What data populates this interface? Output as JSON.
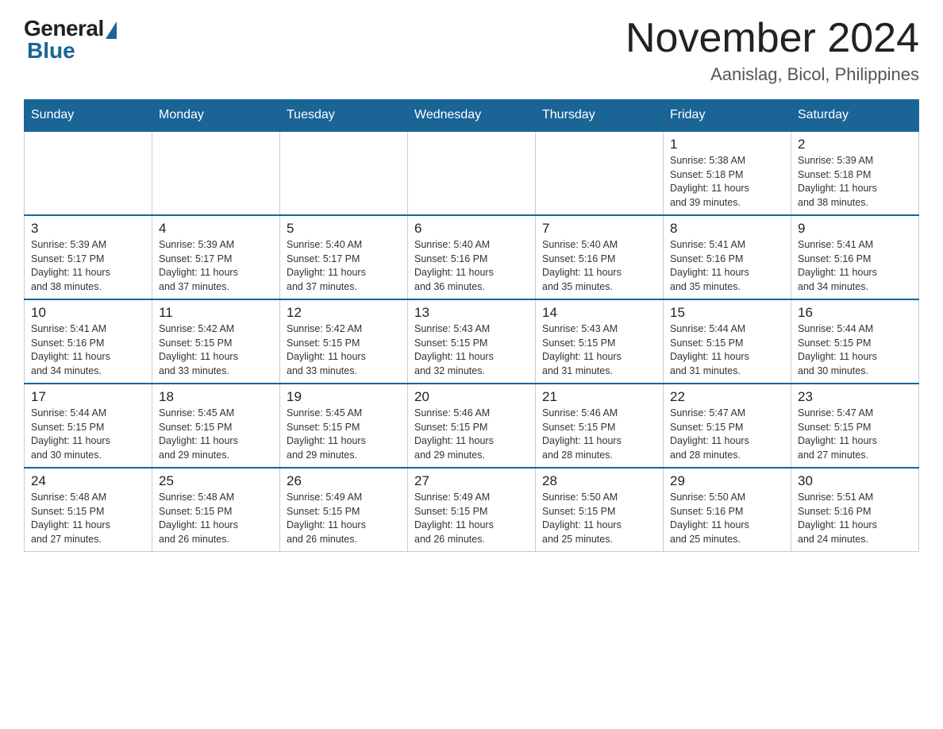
{
  "header": {
    "logo_general": "General",
    "logo_blue": "Blue",
    "month_title": "November 2024",
    "location": "Aanislag, Bicol, Philippines"
  },
  "days_of_week": [
    "Sunday",
    "Monday",
    "Tuesday",
    "Wednesday",
    "Thursday",
    "Friday",
    "Saturday"
  ],
  "weeks": [
    [
      {
        "day": "",
        "info": ""
      },
      {
        "day": "",
        "info": ""
      },
      {
        "day": "",
        "info": ""
      },
      {
        "day": "",
        "info": ""
      },
      {
        "day": "",
        "info": ""
      },
      {
        "day": "1",
        "info": "Sunrise: 5:38 AM\nSunset: 5:18 PM\nDaylight: 11 hours\nand 39 minutes."
      },
      {
        "day": "2",
        "info": "Sunrise: 5:39 AM\nSunset: 5:18 PM\nDaylight: 11 hours\nand 38 minutes."
      }
    ],
    [
      {
        "day": "3",
        "info": "Sunrise: 5:39 AM\nSunset: 5:17 PM\nDaylight: 11 hours\nand 38 minutes."
      },
      {
        "day": "4",
        "info": "Sunrise: 5:39 AM\nSunset: 5:17 PM\nDaylight: 11 hours\nand 37 minutes."
      },
      {
        "day": "5",
        "info": "Sunrise: 5:40 AM\nSunset: 5:17 PM\nDaylight: 11 hours\nand 37 minutes."
      },
      {
        "day": "6",
        "info": "Sunrise: 5:40 AM\nSunset: 5:16 PM\nDaylight: 11 hours\nand 36 minutes."
      },
      {
        "day": "7",
        "info": "Sunrise: 5:40 AM\nSunset: 5:16 PM\nDaylight: 11 hours\nand 35 minutes."
      },
      {
        "day": "8",
        "info": "Sunrise: 5:41 AM\nSunset: 5:16 PM\nDaylight: 11 hours\nand 35 minutes."
      },
      {
        "day": "9",
        "info": "Sunrise: 5:41 AM\nSunset: 5:16 PM\nDaylight: 11 hours\nand 34 minutes."
      }
    ],
    [
      {
        "day": "10",
        "info": "Sunrise: 5:41 AM\nSunset: 5:16 PM\nDaylight: 11 hours\nand 34 minutes."
      },
      {
        "day": "11",
        "info": "Sunrise: 5:42 AM\nSunset: 5:15 PM\nDaylight: 11 hours\nand 33 minutes."
      },
      {
        "day": "12",
        "info": "Sunrise: 5:42 AM\nSunset: 5:15 PM\nDaylight: 11 hours\nand 33 minutes."
      },
      {
        "day": "13",
        "info": "Sunrise: 5:43 AM\nSunset: 5:15 PM\nDaylight: 11 hours\nand 32 minutes."
      },
      {
        "day": "14",
        "info": "Sunrise: 5:43 AM\nSunset: 5:15 PM\nDaylight: 11 hours\nand 31 minutes."
      },
      {
        "day": "15",
        "info": "Sunrise: 5:44 AM\nSunset: 5:15 PM\nDaylight: 11 hours\nand 31 minutes."
      },
      {
        "day": "16",
        "info": "Sunrise: 5:44 AM\nSunset: 5:15 PM\nDaylight: 11 hours\nand 30 minutes."
      }
    ],
    [
      {
        "day": "17",
        "info": "Sunrise: 5:44 AM\nSunset: 5:15 PM\nDaylight: 11 hours\nand 30 minutes."
      },
      {
        "day": "18",
        "info": "Sunrise: 5:45 AM\nSunset: 5:15 PM\nDaylight: 11 hours\nand 29 minutes."
      },
      {
        "day": "19",
        "info": "Sunrise: 5:45 AM\nSunset: 5:15 PM\nDaylight: 11 hours\nand 29 minutes."
      },
      {
        "day": "20",
        "info": "Sunrise: 5:46 AM\nSunset: 5:15 PM\nDaylight: 11 hours\nand 29 minutes."
      },
      {
        "day": "21",
        "info": "Sunrise: 5:46 AM\nSunset: 5:15 PM\nDaylight: 11 hours\nand 28 minutes."
      },
      {
        "day": "22",
        "info": "Sunrise: 5:47 AM\nSunset: 5:15 PM\nDaylight: 11 hours\nand 28 minutes."
      },
      {
        "day": "23",
        "info": "Sunrise: 5:47 AM\nSunset: 5:15 PM\nDaylight: 11 hours\nand 27 minutes."
      }
    ],
    [
      {
        "day": "24",
        "info": "Sunrise: 5:48 AM\nSunset: 5:15 PM\nDaylight: 11 hours\nand 27 minutes."
      },
      {
        "day": "25",
        "info": "Sunrise: 5:48 AM\nSunset: 5:15 PM\nDaylight: 11 hours\nand 26 minutes."
      },
      {
        "day": "26",
        "info": "Sunrise: 5:49 AM\nSunset: 5:15 PM\nDaylight: 11 hours\nand 26 minutes."
      },
      {
        "day": "27",
        "info": "Sunrise: 5:49 AM\nSunset: 5:15 PM\nDaylight: 11 hours\nand 26 minutes."
      },
      {
        "day": "28",
        "info": "Sunrise: 5:50 AM\nSunset: 5:15 PM\nDaylight: 11 hours\nand 25 minutes."
      },
      {
        "day": "29",
        "info": "Sunrise: 5:50 AM\nSunset: 5:16 PM\nDaylight: 11 hours\nand 25 minutes."
      },
      {
        "day": "30",
        "info": "Sunrise: 5:51 AM\nSunset: 5:16 PM\nDaylight: 11 hours\nand 24 minutes."
      }
    ]
  ]
}
